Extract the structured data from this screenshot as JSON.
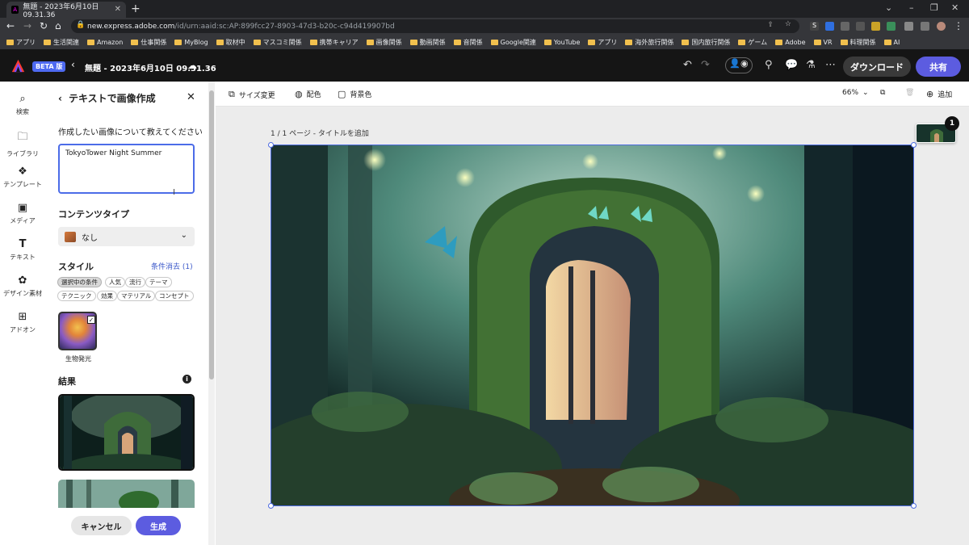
{
  "browser": {
    "tab_title": "無題 - 2023年6月10日 09.31.36",
    "url_host": "new.express.adobe.com",
    "url_path": "/id/urn:aaid:sc:AP:899fcc27-8903-47d3-b20c-c94d419907bd",
    "bookmarks": [
      "アプリ",
      "生活関連",
      "Amazon",
      "仕事関係",
      "MyBlog",
      "取材中",
      "マスコミ関係",
      "携帯キャリア",
      "画像関係",
      "動画関係",
      "音関係",
      "Google関連",
      "YouTube",
      "アプリ",
      "海外旅行関係",
      "国内旅行関係",
      "ゲーム",
      "Adobe",
      "VR",
      "料理関係",
      "AI"
    ]
  },
  "app": {
    "beta_label": "BETA 版",
    "doc_title": "無題 - 2023年6月10日 09.31.36",
    "download_label": "ダウンロード",
    "share_label": "共有",
    "accent": "#5c5ce0"
  },
  "rail": [
    {
      "icon": "search-icon",
      "label": "検索"
    },
    {
      "icon": "folder-icon",
      "label": "ライブラリ"
    },
    {
      "icon": "template-icon",
      "label": "テンプレート"
    },
    {
      "icon": "media-icon",
      "label": "メディア"
    },
    {
      "icon": "text-icon",
      "label": "テキスト"
    },
    {
      "icon": "design-assets-icon",
      "label": "デザイン素材"
    },
    {
      "icon": "addon-icon",
      "label": "アドオン"
    }
  ],
  "panel": {
    "title": "テキストで画像作成",
    "prompt_label": "作成したい画像について教えてください",
    "prompt_value": "TokyoTower Night Summer",
    "content_type_label": "コンテンツタイプ",
    "content_type_value": "なし",
    "style_label": "スタイル",
    "clear_label": "条件消去 (1)",
    "chips_row1": [
      "選択中の条件",
      "人気",
      "流行",
      "テーマ"
    ],
    "chips_row2": [
      "テクニック",
      "効果",
      "マテリアル",
      "コンセプト"
    ],
    "selected_style": "生物発光",
    "results_label": "結果",
    "cancel_label": "キャンセル",
    "generate_label": "生成"
  },
  "toolbar": {
    "resize_label": "サイズ変更",
    "color_label": "配色",
    "bg_label": "背景色",
    "zoom": "66%",
    "add_label": "追加"
  },
  "canvas": {
    "page_label": "1 / 1 ページ - タイトルを追加",
    "page_count": "1"
  }
}
